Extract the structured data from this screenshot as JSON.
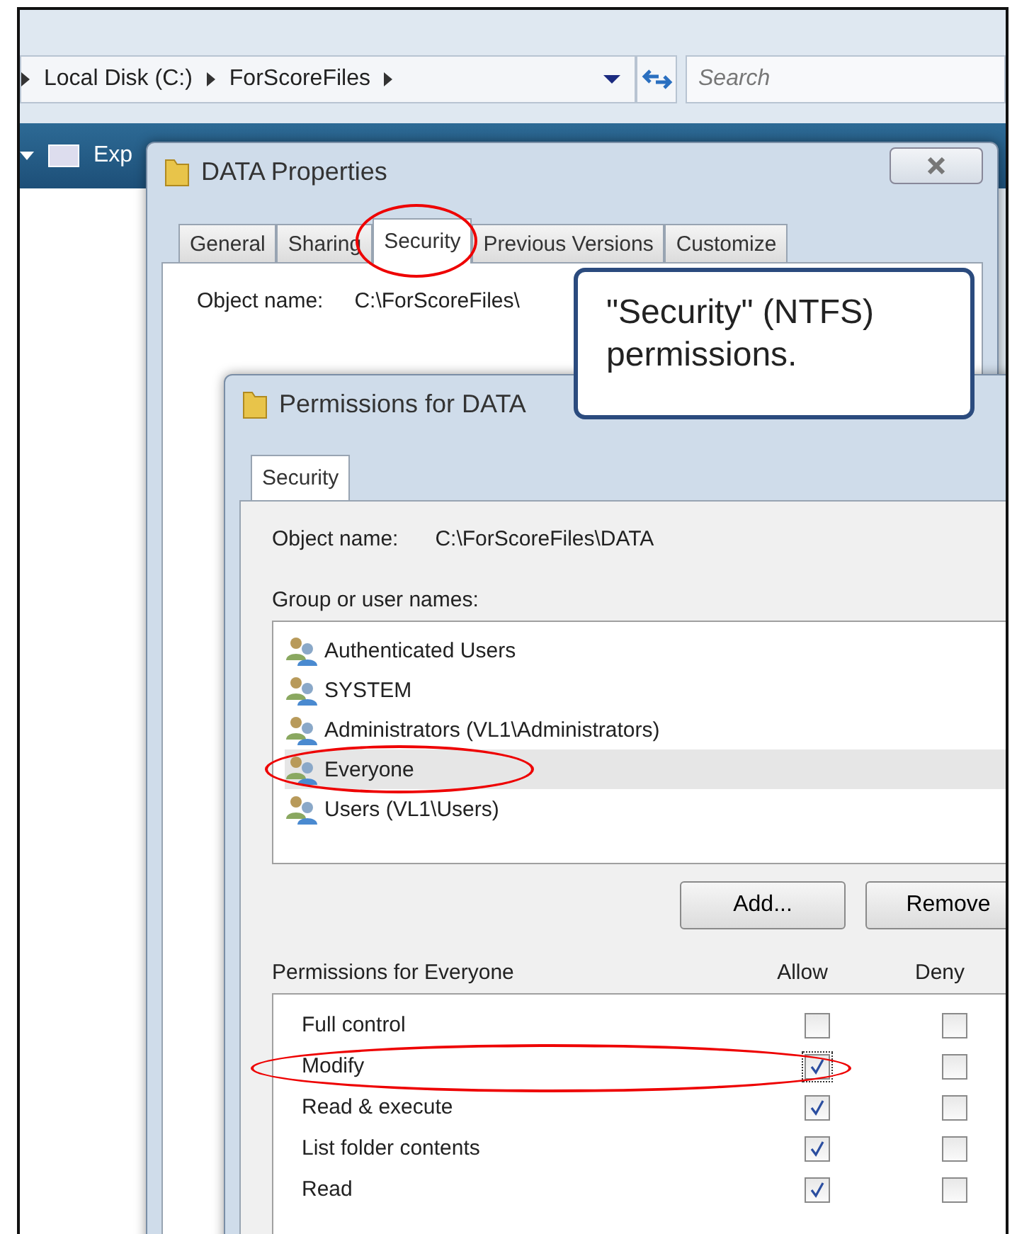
{
  "explorer": {
    "breadcrumb": [
      "Local Disk (C:)",
      "ForScoreFiles"
    ],
    "search": {
      "placeholder": "Search"
    },
    "toolbar": [
      "Exp"
    ]
  },
  "properties_dialog": {
    "title": "DATA Properties",
    "tabs": [
      {
        "label": "General",
        "selected": false,
        "circled": false
      },
      {
        "label": "Sharing",
        "selected": false,
        "circled": false
      },
      {
        "label": "Security",
        "selected": true,
        "circled": true
      },
      {
        "label": "Previous Versions",
        "selected": false,
        "circled": false
      },
      {
        "label": "Customize",
        "selected": false,
        "circled": false
      }
    ],
    "object_label": "Object name:",
    "object_value": "C:\\ForScoreFiles\\"
  },
  "callout": {
    "text": "\"Security\" (NTFS) permissions."
  },
  "permissions_dialog": {
    "title": "Permissions for DATA",
    "tabs": [
      {
        "label": "Security",
        "selected": true
      }
    ],
    "object_label": "Object name:",
    "object_value": "C:\\ForScoreFiles\\DATA",
    "group_label": "Group or user names:",
    "users": [
      {
        "name": "Authenticated Users",
        "selected": false,
        "circled": false
      },
      {
        "name": "SYSTEM",
        "selected": false,
        "circled": false
      },
      {
        "name": "Administrators (VL1\\Administrators)",
        "selected": false,
        "circled": false
      },
      {
        "name": "Everyone",
        "selected": true,
        "circled": true
      },
      {
        "name": "Users (VL1\\Users)",
        "selected": false,
        "circled": false
      }
    ],
    "buttons": [
      "Add...",
      "Remove"
    ],
    "permissions_label": "Permissions for Everyone",
    "columns": [
      "Allow",
      "Deny"
    ],
    "permissions": [
      {
        "name": "Full control",
        "allow": false,
        "deny": false,
        "circled": false
      },
      {
        "name": "Modify",
        "allow": true,
        "deny": false,
        "circled": true
      },
      {
        "name": "Read & execute",
        "allow": true,
        "deny": false,
        "circled": false
      },
      {
        "name": "List folder contents",
        "allow": true,
        "deny": false,
        "circled": false
      },
      {
        "name": "Read",
        "allow": true,
        "deny": false,
        "circled": false
      }
    ]
  }
}
